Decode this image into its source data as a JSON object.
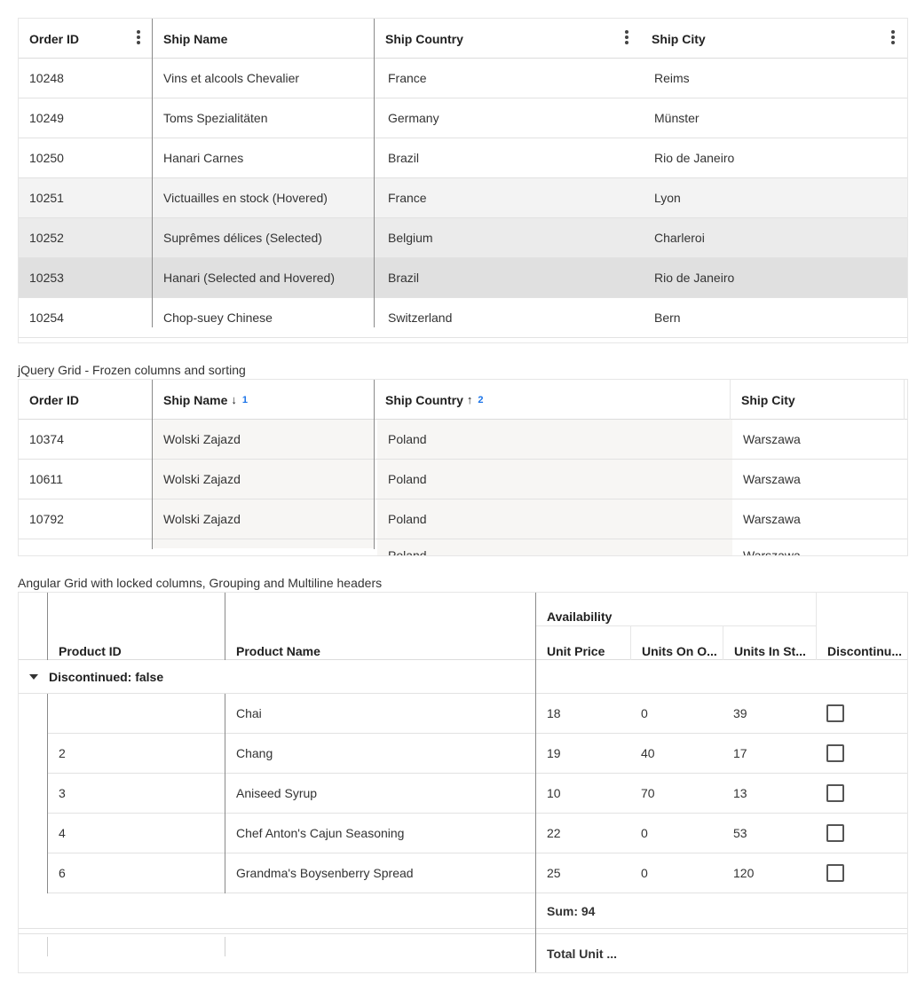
{
  "grid1": {
    "headers": [
      "Order ID",
      "Ship Name",
      "Ship Country",
      "Ship City"
    ],
    "rows": [
      {
        "id": "10248",
        "name": "Vins et alcools Chevalier",
        "country": "France",
        "city": "Reims"
      },
      {
        "id": "10249",
        "name": "Toms Spezialitäten",
        "country": "Germany",
        "city": "Münster"
      },
      {
        "id": "10250",
        "name": "Hanari Carnes",
        "country": "Brazil",
        "city": "Rio de Janeiro"
      },
      {
        "id": "10251",
        "name": "Victuailles en stock (Hovered)",
        "country": "France",
        "city": "Lyon"
      },
      {
        "id": "10252",
        "name": "Suprêmes délices (Selected)",
        "country": "Belgium",
        "city": "Charleroi"
      },
      {
        "id": "10253",
        "name": "Hanari (Selected and Hovered)",
        "country": "Brazil",
        "city": "Rio de Janeiro"
      },
      {
        "id": "10254",
        "name": "Chop-suey Chinese",
        "country": "Switzerland",
        "city": "Bern"
      }
    ]
  },
  "grid2": {
    "caption": "jQuery Grid - Frozen columns and sorting",
    "headers": [
      "Order ID",
      "Ship Name",
      "Ship Country",
      "Ship City"
    ],
    "sort_arrow_down": "↓",
    "sort_arrow_up": "↑",
    "sort_index_1": "1",
    "sort_index_2": "2",
    "rows": [
      {
        "id": "10374",
        "name": "Wolski Zajazd",
        "country": "Poland",
        "city": "Warszawa"
      },
      {
        "id": "10611",
        "name": "Wolski Zajazd",
        "country": "Poland",
        "city": "Warszawa"
      },
      {
        "id": "10792",
        "name": "Wolski Zajazd",
        "country": "Poland",
        "city": "Warszawa"
      },
      {
        "id": "",
        "name": "",
        "country": "Poland",
        "city": "Warszawa"
      }
    ]
  },
  "grid3": {
    "caption": "Angular Grid with locked columns, Grouping and Multiline headers",
    "headers": {
      "product_id": "Product ID",
      "product_name": "Product Name",
      "availability": "Availability",
      "unit_price": "Unit Price",
      "units_on_order": "Units On O...",
      "units_in_stock": "Units In St...",
      "discontinued": "Discontinu..."
    },
    "group_label": "Discontinued: false",
    "rows": [
      {
        "id": "",
        "name": "Chai",
        "price": "18",
        "on_order": "0",
        "in_stock": "39",
        "discontinued": false
      },
      {
        "id": "2",
        "name": "Chang",
        "price": "19",
        "on_order": "40",
        "in_stock": "17",
        "discontinued": false
      },
      {
        "id": "3",
        "name": "Aniseed Syrup",
        "price": "10",
        "on_order": "70",
        "in_stock": "13",
        "discontinued": false
      },
      {
        "id": "4",
        "name": "Chef Anton's Cajun Seasoning",
        "price": "22",
        "on_order": "0",
        "in_stock": "53",
        "discontinued": false
      },
      {
        "id": "6",
        "name": "Grandma's Boysenberry Spread",
        "price": "25",
        "on_order": "0",
        "in_stock": "120",
        "discontinued": false
      }
    ],
    "group_footer": "Sum: 94",
    "footer": "Total Unit ..."
  }
}
